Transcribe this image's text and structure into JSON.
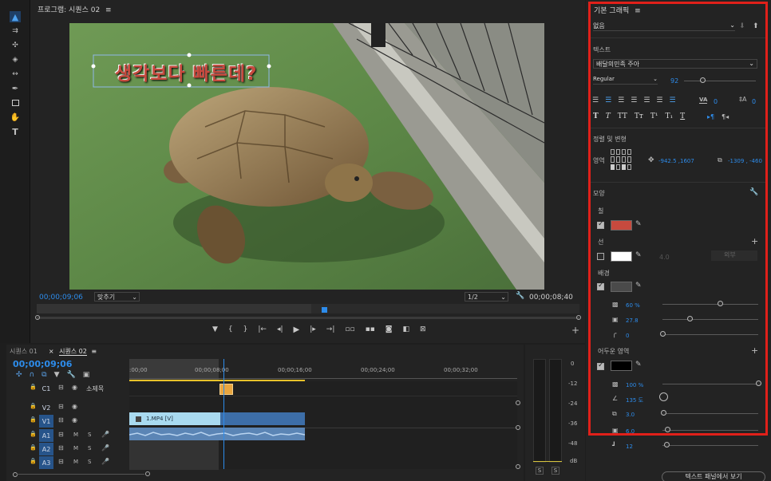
{
  "program_monitor": {
    "title": "프로그램: 시퀀스 02",
    "menu_icon": "hamburger-icon",
    "overlay_text": "생각보다 빠른데?",
    "timecode": "00;00;09;06",
    "fit_label": "맞추기",
    "resolution": "1/2",
    "duration": "00;00;08;40",
    "playhead_progress": 0.72
  },
  "tools": [
    "selection-tool",
    "track-select-tool",
    "ripple-edit-tool",
    "razor-tool",
    "slip-tool",
    "pen-tool",
    "rectangle-tool",
    "hand-tool",
    "type-tool"
  ],
  "timeline": {
    "tabs": [
      {
        "label": "시퀀스 01",
        "active": false
      },
      {
        "label": "시퀀스 02",
        "active": true
      }
    ],
    "close_symbol": "×",
    "menu_icon": "≡",
    "timecode": "00;00;09;06",
    "ruler": [
      ":00;00",
      "00;00;08;00",
      "00;00;16;00",
      "00;00;24;00",
      "00;00;32;00"
    ],
    "tracks": [
      {
        "id": "C1",
        "name": "소제목"
      },
      {
        "id": "V2",
        "name": ""
      },
      {
        "id": "V1",
        "name": ""
      },
      {
        "id": "A1",
        "name": ""
      },
      {
        "id": "A2",
        "name": ""
      },
      {
        "id": "A3",
        "name": ""
      }
    ],
    "track_flags": {
      "m": "M",
      "s": "S"
    },
    "clip_v1": "1.MP4 [V]",
    "clip_badge": "fx"
  },
  "audio_meter": {
    "scale": [
      "0",
      "-12",
      "-24",
      "-36",
      "-48",
      "dB"
    ],
    "solo": [
      "S",
      "S"
    ]
  },
  "essential_graphics": {
    "title": "기본 그래픽",
    "menu_icon": "≡",
    "preset": "없음",
    "text_section": "텍스트",
    "font": "배달의민족 주아",
    "style": "Regular",
    "size": "92",
    "size_fraction": 0.26,
    "kerning": "0",
    "leading": "0",
    "align_section": "정렬 및 변형",
    "area_label": "영역",
    "position": "-942.5 ,1607",
    "scale_value": "-1309 , -460",
    "appearance_section": "모양",
    "fill_label": "칠",
    "fill_color": "#c74a3e",
    "stroke_label": "선",
    "stroke_color": "#ffffff",
    "stroke_width": "4.0",
    "stroke_type": "외부",
    "background_label": "배경",
    "background_color": "#4a4a4a",
    "bg_opacity": "60 %",
    "bg_opacity_fraction": 0.6,
    "bg_size": "27.8",
    "bg_size_fraction": 0.28,
    "bg_corner": "0",
    "shadow_section": "어두운 영역",
    "shadow_color": "#000000",
    "shadow_opacity": "100 %",
    "shadow_angle": "135 도",
    "shadow_distance": "3.0",
    "shadow_size": "6.0",
    "shadow_blur": "12",
    "footer_button": "텍스트 패널에서 보기",
    "highlight_color": "#e0201a"
  }
}
